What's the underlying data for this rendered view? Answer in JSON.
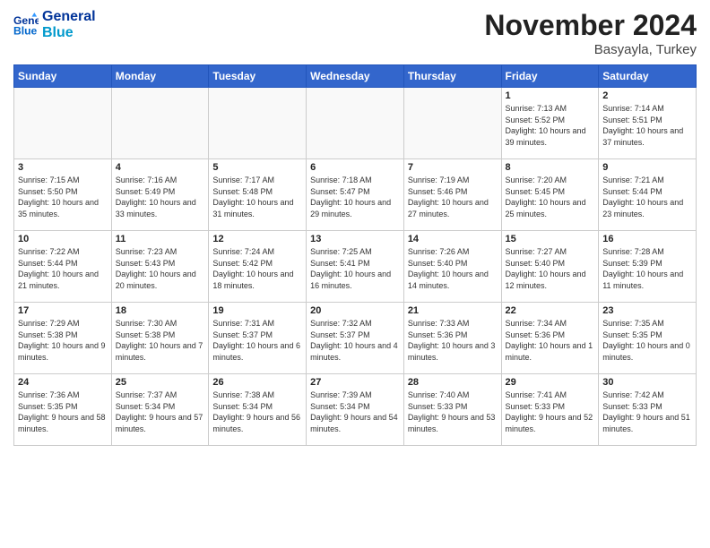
{
  "header": {
    "logo_line1": "General",
    "logo_line2": "Blue",
    "month_title": "November 2024",
    "location": "Basyayla, Turkey"
  },
  "days_of_week": [
    "Sunday",
    "Monday",
    "Tuesday",
    "Wednesday",
    "Thursday",
    "Friday",
    "Saturday"
  ],
  "weeks": [
    [
      {
        "day": "",
        "info": ""
      },
      {
        "day": "",
        "info": ""
      },
      {
        "day": "",
        "info": ""
      },
      {
        "day": "",
        "info": ""
      },
      {
        "day": "",
        "info": ""
      },
      {
        "day": "1",
        "info": "Sunrise: 7:13 AM\nSunset: 5:52 PM\nDaylight: 10 hours and 39 minutes."
      },
      {
        "day": "2",
        "info": "Sunrise: 7:14 AM\nSunset: 5:51 PM\nDaylight: 10 hours and 37 minutes."
      }
    ],
    [
      {
        "day": "3",
        "info": "Sunrise: 7:15 AM\nSunset: 5:50 PM\nDaylight: 10 hours and 35 minutes."
      },
      {
        "day": "4",
        "info": "Sunrise: 7:16 AM\nSunset: 5:49 PM\nDaylight: 10 hours and 33 minutes."
      },
      {
        "day": "5",
        "info": "Sunrise: 7:17 AM\nSunset: 5:48 PM\nDaylight: 10 hours and 31 minutes."
      },
      {
        "day": "6",
        "info": "Sunrise: 7:18 AM\nSunset: 5:47 PM\nDaylight: 10 hours and 29 minutes."
      },
      {
        "day": "7",
        "info": "Sunrise: 7:19 AM\nSunset: 5:46 PM\nDaylight: 10 hours and 27 minutes."
      },
      {
        "day": "8",
        "info": "Sunrise: 7:20 AM\nSunset: 5:45 PM\nDaylight: 10 hours and 25 minutes."
      },
      {
        "day": "9",
        "info": "Sunrise: 7:21 AM\nSunset: 5:44 PM\nDaylight: 10 hours and 23 minutes."
      }
    ],
    [
      {
        "day": "10",
        "info": "Sunrise: 7:22 AM\nSunset: 5:44 PM\nDaylight: 10 hours and 21 minutes."
      },
      {
        "day": "11",
        "info": "Sunrise: 7:23 AM\nSunset: 5:43 PM\nDaylight: 10 hours and 20 minutes."
      },
      {
        "day": "12",
        "info": "Sunrise: 7:24 AM\nSunset: 5:42 PM\nDaylight: 10 hours and 18 minutes."
      },
      {
        "day": "13",
        "info": "Sunrise: 7:25 AM\nSunset: 5:41 PM\nDaylight: 10 hours and 16 minutes."
      },
      {
        "day": "14",
        "info": "Sunrise: 7:26 AM\nSunset: 5:40 PM\nDaylight: 10 hours and 14 minutes."
      },
      {
        "day": "15",
        "info": "Sunrise: 7:27 AM\nSunset: 5:40 PM\nDaylight: 10 hours and 12 minutes."
      },
      {
        "day": "16",
        "info": "Sunrise: 7:28 AM\nSunset: 5:39 PM\nDaylight: 10 hours and 11 minutes."
      }
    ],
    [
      {
        "day": "17",
        "info": "Sunrise: 7:29 AM\nSunset: 5:38 PM\nDaylight: 10 hours and 9 minutes."
      },
      {
        "day": "18",
        "info": "Sunrise: 7:30 AM\nSunset: 5:38 PM\nDaylight: 10 hours and 7 minutes."
      },
      {
        "day": "19",
        "info": "Sunrise: 7:31 AM\nSunset: 5:37 PM\nDaylight: 10 hours and 6 minutes."
      },
      {
        "day": "20",
        "info": "Sunrise: 7:32 AM\nSunset: 5:37 PM\nDaylight: 10 hours and 4 minutes."
      },
      {
        "day": "21",
        "info": "Sunrise: 7:33 AM\nSunset: 5:36 PM\nDaylight: 10 hours and 3 minutes."
      },
      {
        "day": "22",
        "info": "Sunrise: 7:34 AM\nSunset: 5:36 PM\nDaylight: 10 hours and 1 minute."
      },
      {
        "day": "23",
        "info": "Sunrise: 7:35 AM\nSunset: 5:35 PM\nDaylight: 10 hours and 0 minutes."
      }
    ],
    [
      {
        "day": "24",
        "info": "Sunrise: 7:36 AM\nSunset: 5:35 PM\nDaylight: 9 hours and 58 minutes."
      },
      {
        "day": "25",
        "info": "Sunrise: 7:37 AM\nSunset: 5:34 PM\nDaylight: 9 hours and 57 minutes."
      },
      {
        "day": "26",
        "info": "Sunrise: 7:38 AM\nSunset: 5:34 PM\nDaylight: 9 hours and 56 minutes."
      },
      {
        "day": "27",
        "info": "Sunrise: 7:39 AM\nSunset: 5:34 PM\nDaylight: 9 hours and 54 minutes."
      },
      {
        "day": "28",
        "info": "Sunrise: 7:40 AM\nSunset: 5:33 PM\nDaylight: 9 hours and 53 minutes."
      },
      {
        "day": "29",
        "info": "Sunrise: 7:41 AM\nSunset: 5:33 PM\nDaylight: 9 hours and 52 minutes."
      },
      {
        "day": "30",
        "info": "Sunrise: 7:42 AM\nSunset: 5:33 PM\nDaylight: 9 hours and 51 minutes."
      }
    ]
  ]
}
